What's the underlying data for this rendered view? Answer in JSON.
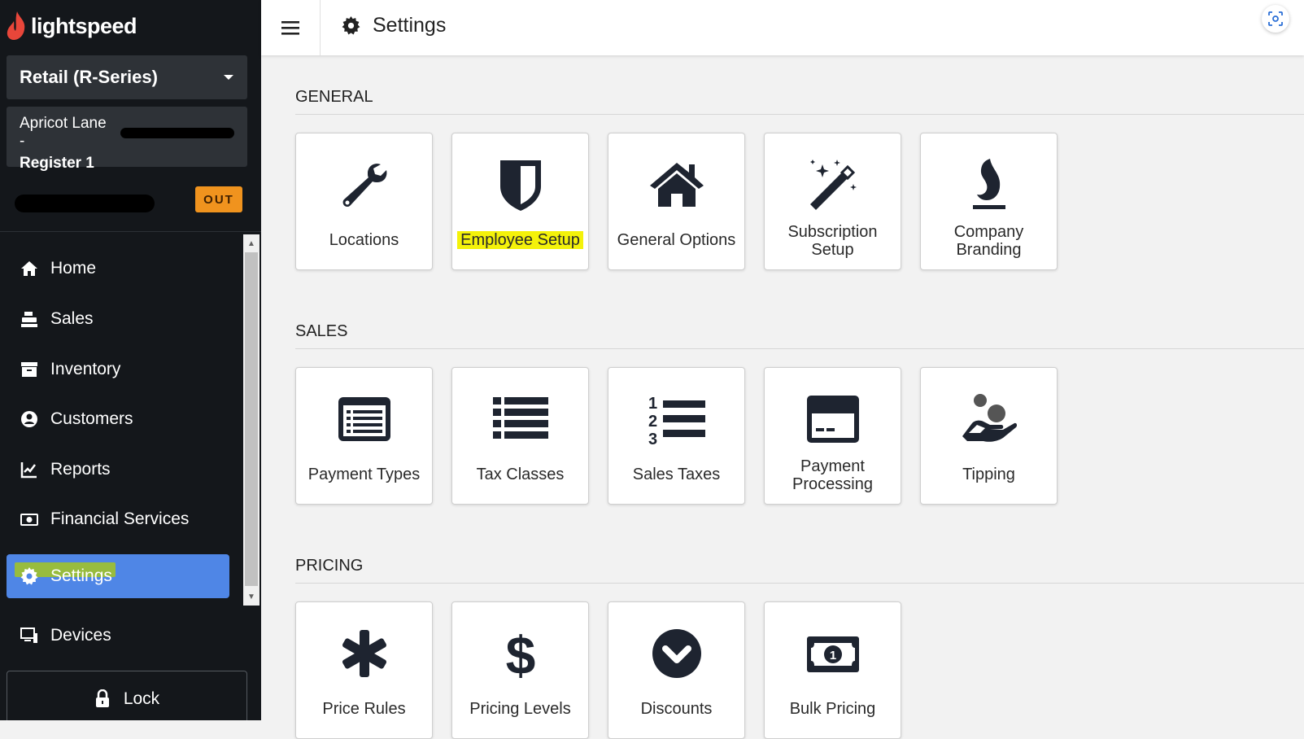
{
  "app": {
    "logo_text": "lightspeed"
  },
  "sidebar": {
    "store_selector": {
      "label": "Retail (R-Series)"
    },
    "register": {
      "location": "Apricot Lane -",
      "name": "Register 1"
    },
    "clock_status": "OUT",
    "nav": {
      "home": "Home",
      "sales": "Sales",
      "inventory": "Inventory",
      "customers": "Customers",
      "reports": "Reports",
      "financial": "Financial Services",
      "settings": "Settings",
      "devices": "Devices"
    },
    "active_item": "Settings",
    "lock": "Lock"
  },
  "header": {
    "title": "Settings"
  },
  "sections": {
    "general": {
      "heading": "GENERAL",
      "tiles": {
        "locations": "Locations",
        "employee_setup": "Employee Setup",
        "general_options": "General Options",
        "subscription_1": "Subscription",
        "subscription_2": "Setup",
        "branding_1": "Company",
        "branding_2": "Branding"
      }
    },
    "sales": {
      "heading": "SALES",
      "tiles": {
        "payment_types": "Payment Types",
        "tax_classes": "Tax Classes",
        "sales_taxes": "Sales Taxes",
        "processing_1": "Payment",
        "processing_2": "Processing",
        "tipping": "Tipping"
      }
    },
    "pricing": {
      "heading": "PRICING",
      "tiles": {
        "price_rules": "Price Rules",
        "pricing_levels": "Pricing Levels",
        "discounts": "Discounts",
        "bulk_pricing": "Bulk Pricing"
      }
    }
  },
  "colors": {
    "sidebar_bg": "#14171b",
    "active_nav": "#4f86e6",
    "out_badge": "#f0931e",
    "icon_dark": "#1e2430"
  }
}
